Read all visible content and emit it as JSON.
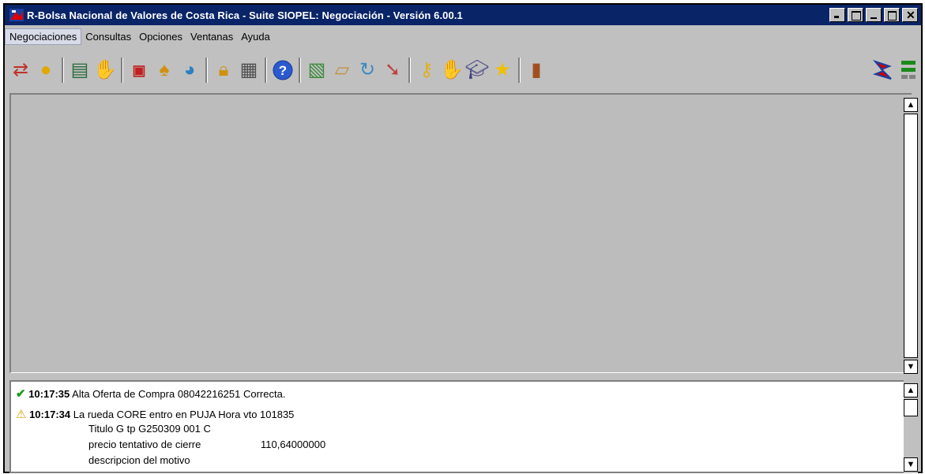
{
  "window": {
    "title": "R-Bolsa Nacional de Valores de Costa Rica - Suite SIOPEL: Negociación - Versión 6.00.1"
  },
  "menu": [
    "Negociaciones",
    "Consultas",
    "Opciones",
    "Ventanas",
    "Ayuda"
  ],
  "toolbar_icons": [
    "refresh-icon",
    "coins-icon",
    "ledger-icon",
    "handshake-icon",
    "report-icon",
    "money-bag-icon",
    "globe-icon",
    "lock-icon",
    "calculator-icon",
    "help-icon",
    "printer-icon",
    "document-icon",
    "sync-icon",
    "download-icon",
    "key-icon",
    "hand-icon",
    "graduate-icon",
    "star-icon",
    "exit-door-icon"
  ],
  "log": {
    "entry1": {
      "time": "10:17:35",
      "text": "Alta Oferta de Compra 08042216251 Correcta."
    },
    "entry2": {
      "time": "10:17:34",
      "text": "La rueda CORE entro en PUJA Hora vto 101835"
    },
    "detail1": "Titulo G tp G250309 001 C",
    "detail2_label": "precio tentativo de cierre",
    "detail2_value": "110,64000000",
    "detail3": "descripcion del motivo"
  }
}
